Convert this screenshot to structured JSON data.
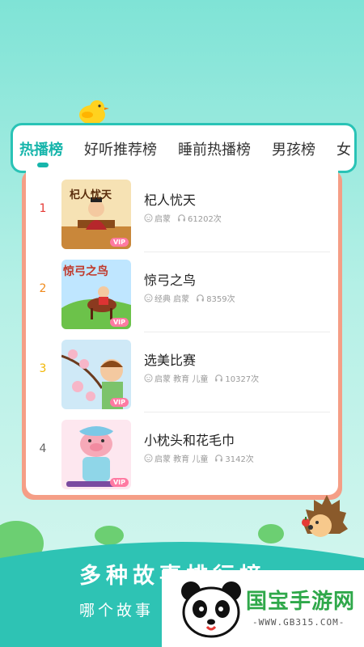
{
  "tabs": [
    {
      "label": "热播榜",
      "active": true
    },
    {
      "label": "好听推荐榜",
      "active": false
    },
    {
      "label": "睡前热播榜",
      "active": false
    },
    {
      "label": "男孩榜",
      "active": false
    },
    {
      "label": "女",
      "active": false
    }
  ],
  "stories": [
    {
      "rank": "1",
      "rank_color": "#e53935",
      "title": "杞人忧天",
      "tags": "启蒙",
      "plays": "61202次",
      "thumb_text": "杞人忧天",
      "vip": "VIP"
    },
    {
      "rank": "2",
      "rank_color": "#f08a1c",
      "title": "惊弓之鸟",
      "tags": "经典 启蒙",
      "plays": "8359次",
      "thumb_text": "惊弓之鸟",
      "vip": "VIP"
    },
    {
      "rank": "3",
      "rank_color": "#f2b705",
      "title": "选美比赛",
      "tags": "启蒙 教育 儿童",
      "plays": "10327次",
      "thumb_text": "",
      "vip": "VIP"
    },
    {
      "rank": "4",
      "rank_color": "#666666",
      "title": "小枕头和花毛巾",
      "tags": "启蒙 教育 儿童",
      "plays": "3142次",
      "thumb_text": "",
      "vip": "VIP"
    }
  ],
  "banner": {
    "headline": "多种故事排行榜",
    "subline": "哪个故事"
  },
  "watermark": {
    "name": "国宝手游网",
    "url": "-WWW.GB315.COM-"
  },
  "colors": {
    "accent": "#17b5ab",
    "tab_border": "#29c3b6",
    "card_frame": "#f59e86"
  }
}
